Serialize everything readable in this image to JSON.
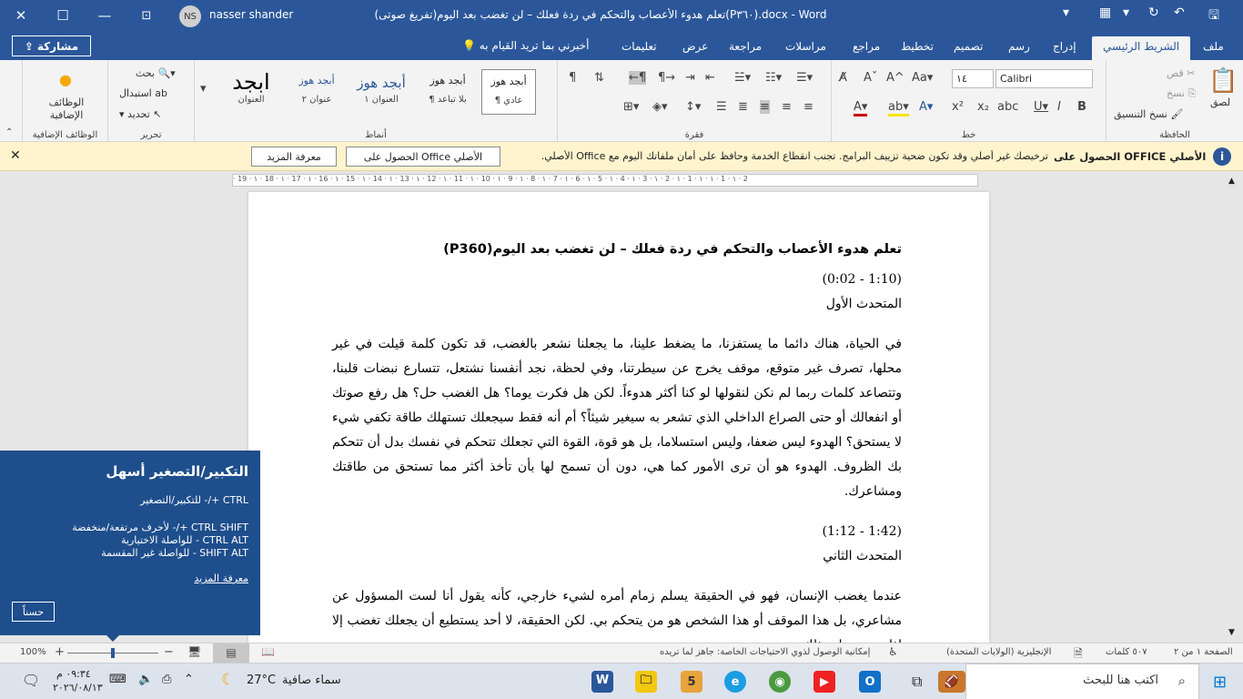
{
  "titlebar": {
    "title": "تعلم هدوء الأعصاب والتحكم في ردة فعلك – لن تغضب بعد اليوم(تفريغ صوتى)(P٣٦٠).docx  -  Word",
    "user_name": "nasser shander",
    "user_initials": "NS",
    "minimize": "—",
    "restore": "☐",
    "close": "✕"
  },
  "tabs": [
    {
      "label": "ملف"
    },
    {
      "label": "الشريط الرئيسي"
    },
    {
      "label": "إدراج"
    },
    {
      "label": "رسم"
    },
    {
      "label": "تصميم"
    },
    {
      "label": "تخطيط"
    },
    {
      "label": "مراجع"
    },
    {
      "label": "مراسلات"
    },
    {
      "label": "مراجعة"
    },
    {
      "label": "عرض"
    },
    {
      "label": "تعليمات"
    }
  ],
  "tell_me": "أخبرني بما تريد القيام به",
  "share_label": "مشاركة",
  "ribbon": {
    "clipboard": {
      "label": "الحافظة",
      "paste": "لصق",
      "cut": "قص",
      "copy": "نسخ",
      "format_painter": "نسخ التنسيق"
    },
    "font": {
      "label": "خط",
      "name": "Calibri",
      "size": "١٤"
    },
    "paragraph": {
      "label": "فقرة"
    },
    "styles": {
      "label": "أنماط",
      "items": [
        {
          "preview": "أبجد هوز",
          "name": "¶ عادي"
        },
        {
          "preview": "أبجد هوز",
          "name": "¶ بلا تباعد"
        },
        {
          "preview": "أبجد هوز",
          "name": "العنوان ١"
        },
        {
          "preview": "أبجد هوز",
          "name": "عنوان ٢"
        },
        {
          "preview": "ابجد",
          "name": "العنوان"
        }
      ]
    },
    "editing": {
      "label": "تحرير",
      "find": "بحث",
      "replace": "استبدال",
      "select": "تحديد"
    },
    "addins": {
      "label": "الوظائف الإضافية",
      "button": "الوظائف الإضافية"
    }
  },
  "message_bar": {
    "title": "الحصول على OFFICE الأصلي",
    "text": "ترخيصك غير أصلي وقد تكون ضحية تزييف البرامج. تجنب انقطاع الخدمة وحافظ على أمان ملفاتك اليوم مع Office الأصلي.",
    "btn_get": "الحصول على Office الأصلي",
    "btn_more": "معرفة المزيد"
  },
  "ruler_text": "· 19 · ۱ · 18 · ۱ · 17 · ۱ · 16 · ۱ · 15 · ۱ · 14 · ۱ · 13 · ۱ · 12 · ۱ · 11 · ۱ · 10 · ۱ · 9 · ۱ · 8 · ۱ · 7 · ۱ · 6 · ۱ · 5 · ۱ · 4 · ۱ · 3 · ۱ · 2 · ۱ · 1 · ۱ · ۱ · 1 · ۱ · 2",
  "document": {
    "heading": "تعلم هدوء الأعصاب والتحكم في ردة فعلك – لن تغضب بعد اليوم(P360)",
    "t1": "(1:10 - 0:02)",
    "s1": "المتحدث الأول",
    "p1": "في الحياة، هناك دائما ما يستفزنا، ما يضغط علينا، ما يجعلنا نشعر بالغضب، قد تكون كلمة قيلت في غير محلها، تصرف غير متوقع، موقف يخرج عن سيطرتنا، وفي لحظة، نجد أنفسنا نشتعل، تتسارع نبضات قلبنا، وتتصاعد كلمات ربما لم نكن لنقولها لو كنا أكثر هدوءاً. لكن هل فكرت يوما؟ هل الغضب حل؟ هل رفع صوتك أو انفعالك أو حتى الصراع الداخلي الذي تشعر به سيغير شيئاً؟ أم أنه فقط سيجعلك تستهلك طاقة تكفي شيء لا يستحق؟ الهدوء ليس ضعفا، وليس استسلاما، بل هو قوة، القوة التي تجعلك تتحكم في نفسك بدل أن تتحكم بك الظروف. الهدوء هو أن ترى الأمور كما هي، دون أن تسمح لها بأن تأخذ أكثر مما تستحق من طاقتك ومشاعرك.",
    "t2": "(1:42 - 1:12)",
    "s2": "المتحدث الثاني",
    "p2": "عندما يغضب الإنسان، فهو في الحقيقة يسلم زمام أمره لشيء خارجي، كأنه يقول أنا لست المسؤول عن مشاعري، بل هذا الموقف أو هذا الشخص هو من يتحكم بي. لكن الحقيقة، لا أحد يستطيع أن يجعلك تغضب إلا إذا سمحت له بذلك."
  },
  "tooltip": {
    "title": "التكبير/التصغير أسهل",
    "line1": "CTRL +/- للتكبير/التصغير",
    "line2": "CTRL SHIFT +/- لأحرف مرتفعة/منخفضة",
    "line3": "CTRL ALT - للواصلة الاختيارية",
    "line4": "SHIFT ALT - للواصلة غير المقسمة",
    "more": "معرفة المزيد",
    "ok": "حسناً"
  },
  "statusbar": {
    "page": "الصفحة ١ من ٢",
    "words": "٥٠٧ كلمات",
    "language": "الإنجليزية (الولايات المتحدة)",
    "accessibility": "إمكانية الوصول لذوي الاحتياجات الخاصة: جاهز لما تريده",
    "zoom": "100%",
    "zoom_level": 0.5
  },
  "taskbar": {
    "search_placeholder": "اكتب هنا للبحث",
    "weather_temp": "27°C",
    "weather_desc": "سماء صافية",
    "time": "٠٩:٣٤ م",
    "date": "٢٠٢٦/٠٨/١٣"
  }
}
